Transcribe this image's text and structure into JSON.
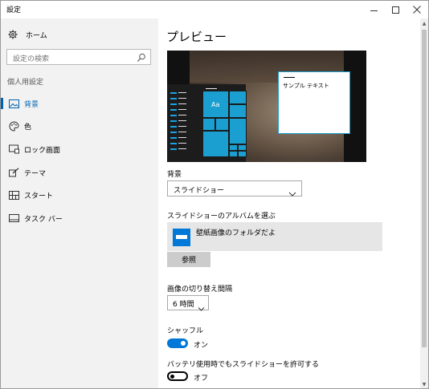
{
  "window": {
    "title": "設定",
    "controls": {
      "minimize": "minimize-icon",
      "maximize": "maximize-icon",
      "close": "close-icon"
    }
  },
  "sidebar": {
    "home_label": "ホーム",
    "search_placeholder": "設定の検索",
    "section_label": "個人用設定",
    "items": [
      {
        "label": "背景",
        "icon": "picture-icon",
        "active": true
      },
      {
        "label": "色",
        "icon": "palette-icon",
        "active": false
      },
      {
        "label": "ロック画面",
        "icon": "lock-screen-icon",
        "active": false
      },
      {
        "label": "テーマ",
        "icon": "brush-icon",
        "active": false
      },
      {
        "label": "スタート",
        "icon": "start-icon",
        "active": false
      },
      {
        "label": "タスク バー",
        "icon": "taskbar-icon",
        "active": false
      }
    ]
  },
  "main": {
    "title": "プレビュー",
    "preview": {
      "tile_label": "Aa",
      "window_text": "サンプル テキスト"
    },
    "background": {
      "label": "背景",
      "value": "スライドショー"
    },
    "album": {
      "label": "スライドショーのアルバムを選ぶ",
      "folder": "壁紙画像のフォルダだよ",
      "browse_label": "参照"
    },
    "interval": {
      "label": "画像の切り替え間隔",
      "value": "6 時間"
    },
    "shuffle": {
      "label": "シャッフル",
      "state": "オン"
    },
    "battery": {
      "label": "バッテリ使用時でもスライドショーを許可する",
      "state": "オフ"
    }
  },
  "colors": {
    "accent": "#0078d7",
    "nav_active": "#0063b1",
    "sidebar_bg": "#f2f2f2",
    "tile": "#1a9fd0"
  }
}
